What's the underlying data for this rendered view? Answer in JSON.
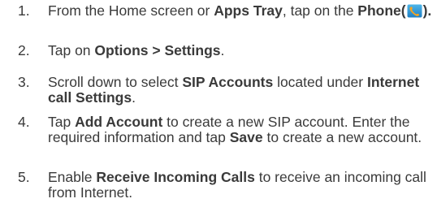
{
  "steps": [
    {
      "number": "1.",
      "parts": [
        {
          "t": "From the Home screen or ",
          "b": false
        },
        {
          "t": "Apps Tray",
          "b": true
        },
        {
          "t": ", tap on the ",
          "b": false
        },
        {
          "t": "Phone",
          "b": true
        },
        {
          "t": "(",
          "b": false
        },
        {
          "icon": "phone-app-icon"
        },
        {
          "t": ").",
          "b": false
        }
      ]
    },
    {
      "number": "2.",
      "parts": [
        {
          "t": "Tap on ",
          "b": false
        },
        {
          "t": "Options > Settings",
          "b": true
        },
        {
          "t": ".",
          "b": false
        }
      ]
    },
    {
      "number": "3.",
      "parts": [
        {
          "t": "Scroll down to select ",
          "b": false
        },
        {
          "t": "SIP Accounts",
          "b": true
        },
        {
          "t": " located under ",
          "b": false
        },
        {
          "t": "Internet call Settings",
          "b": true
        },
        {
          "t": ".",
          "b": false
        }
      ]
    },
    {
      "number": "4.",
      "parts": [
        {
          "t": "Tap ",
          "b": false
        },
        {
          "t": "Add Account",
          "b": true
        },
        {
          "t": " to create a new SIP account. Enter the required information and tap ",
          "b": false
        },
        {
          "t": "Save",
          "b": true
        },
        {
          "t": " to create a new account.",
          "b": false
        }
      ]
    },
    {
      "number": "5.",
      "parts": [
        {
          "t": "Enable ",
          "b": false
        },
        {
          "t": "Receive Incoming Calls",
          "b": true
        },
        {
          "t": " to receive an incoming call from Internet.",
          "b": false
        }
      ]
    }
  ]
}
